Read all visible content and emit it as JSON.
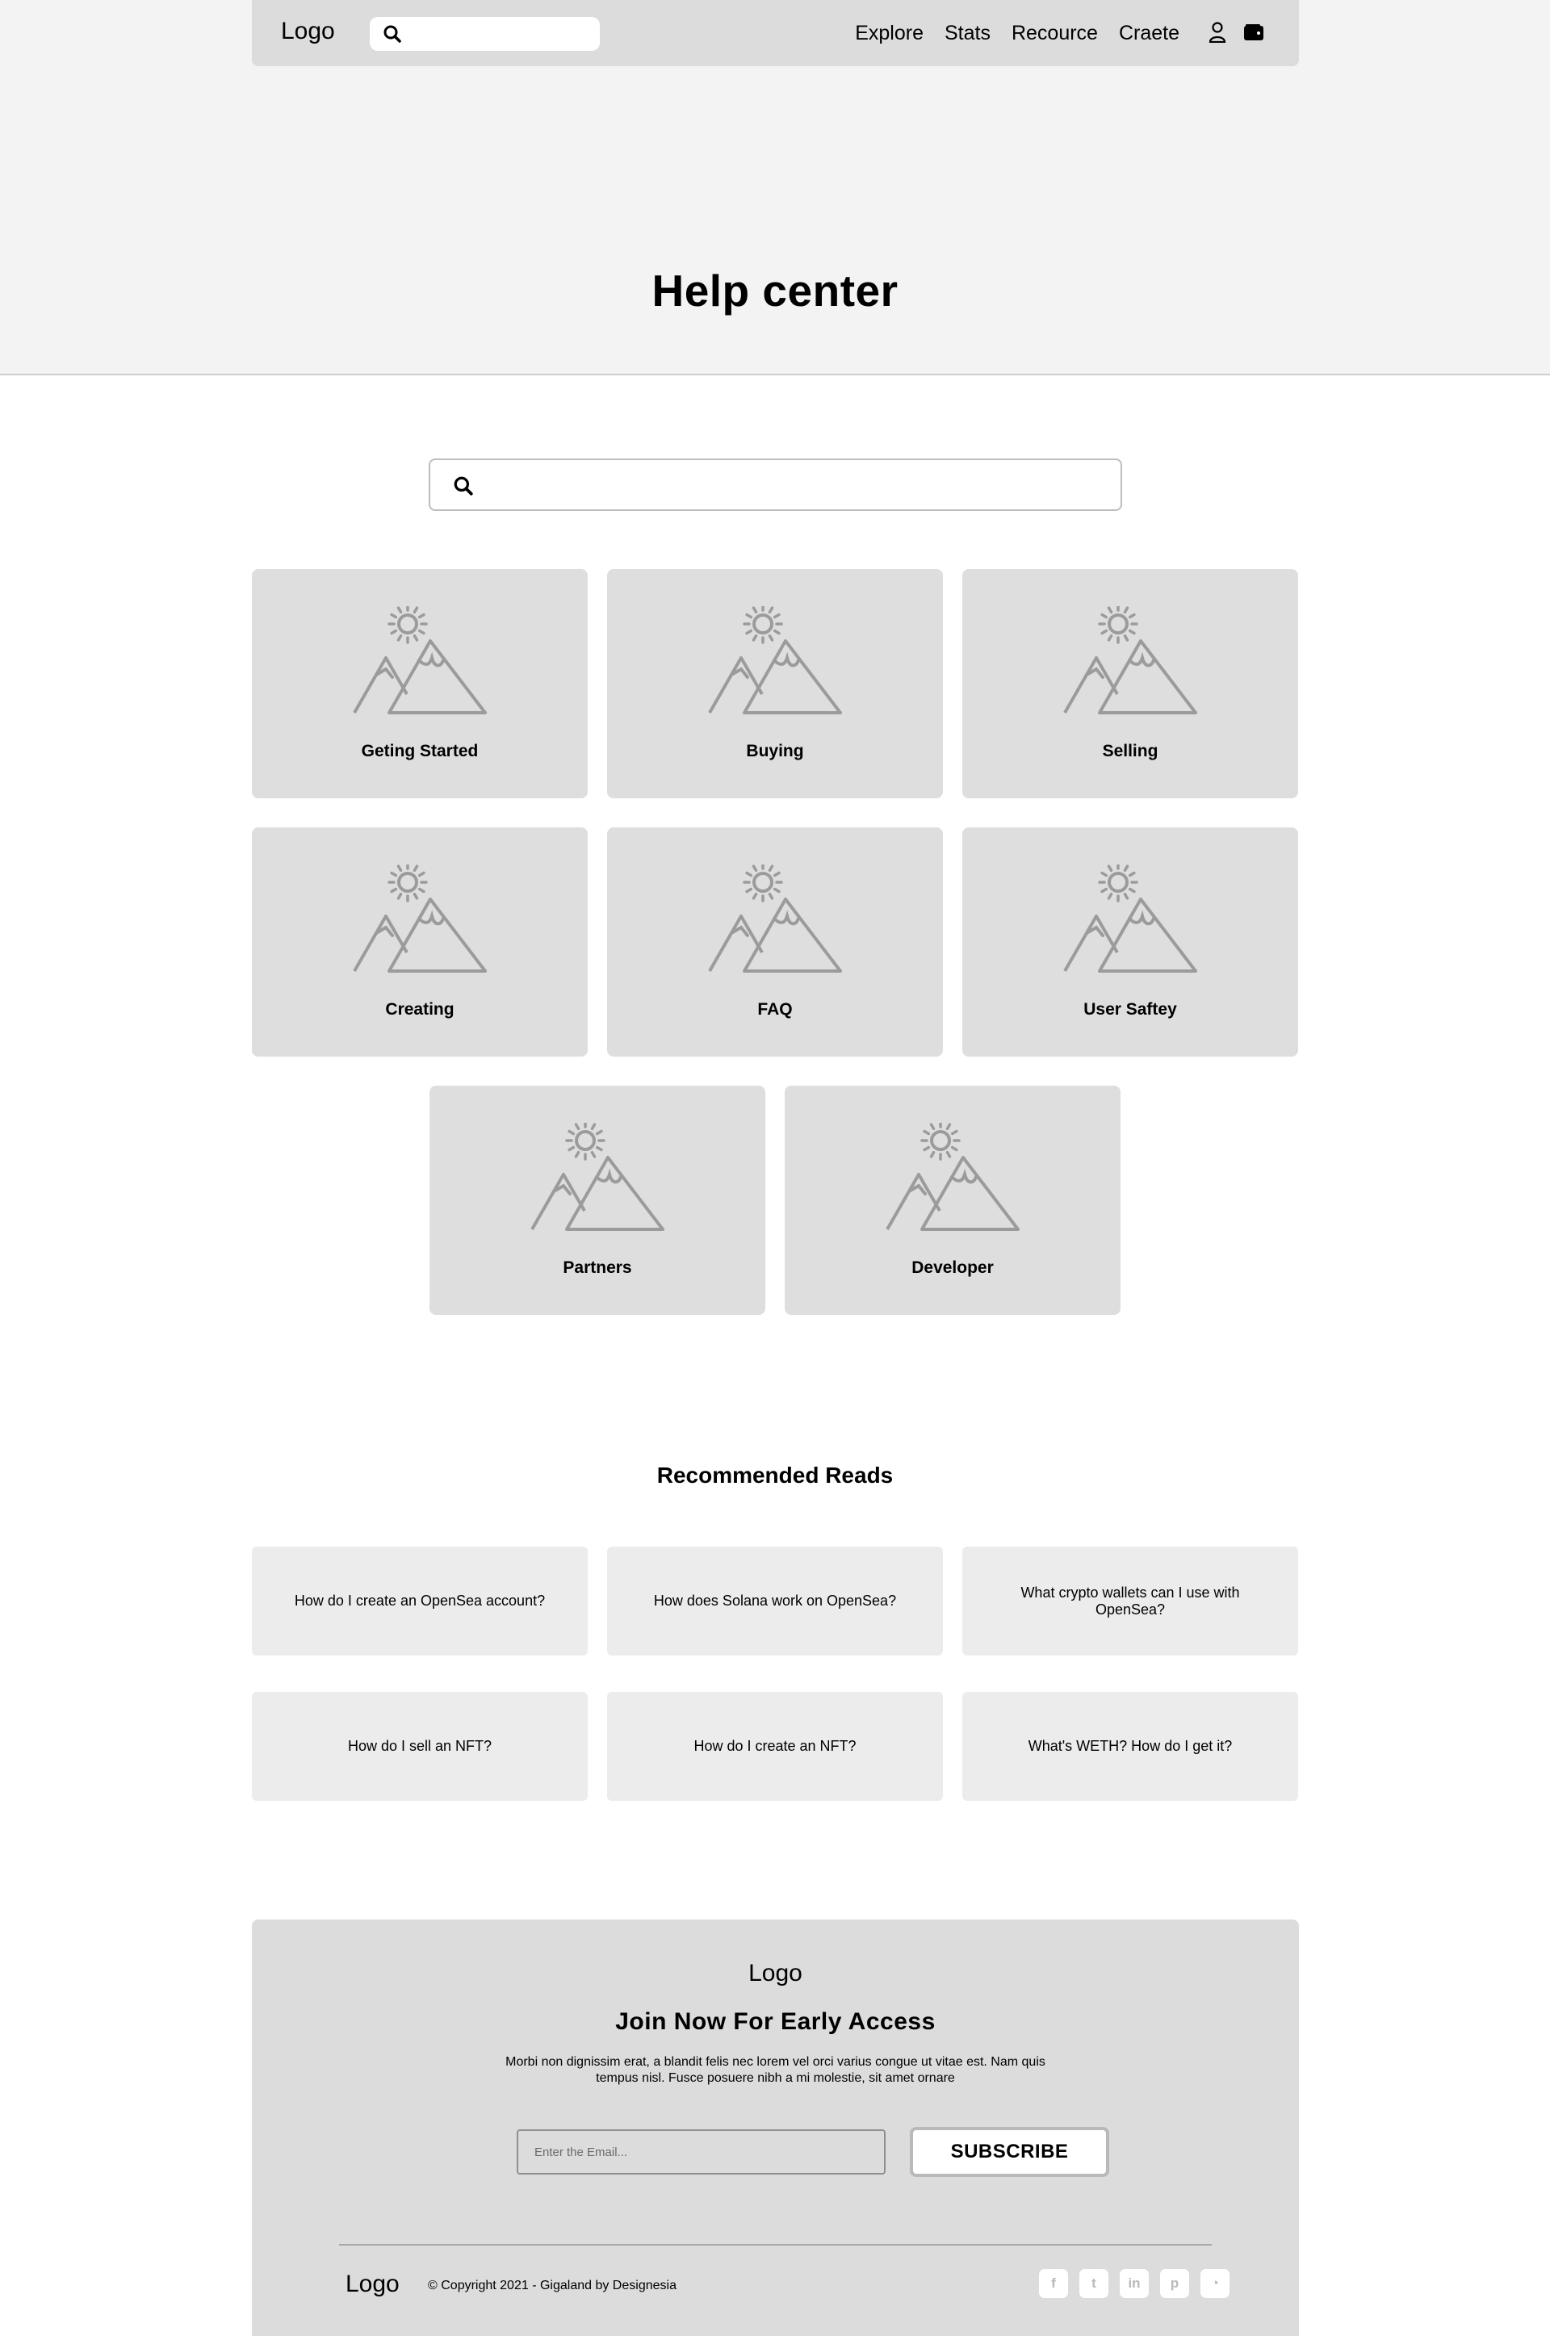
{
  "nav": {
    "logo": "Logo",
    "search_placeholder": "",
    "links": [
      "Explore",
      "Stats",
      "Recource",
      "Craete"
    ]
  },
  "hero": {
    "title": "Help center"
  },
  "search": {
    "placeholder": ""
  },
  "categories": [
    "Geting Started",
    "Buying",
    "Selling",
    "Creating",
    "FAQ",
    "User Saftey",
    "Partners",
    "Developer"
  ],
  "recommended": {
    "title": "Recommended Reads",
    "items": [
      "How do I create an OpenSea account?",
      "How does Solana work on OpenSea?",
      "What crypto wallets can I use with OpenSea?",
      "How do I sell an NFT?",
      "How do I create an NFT?",
      "What's WETH? How do I get it?"
    ]
  },
  "footer": {
    "logo": "Logo",
    "title": "Join Now For Early Access",
    "description": "Morbi non dignissim erat, a blandit felis nec lorem vel orci varius congue ut vitae est. Nam quis tempus nisl. Fusce posuere nibh a mi molestie, sit amet ornare",
    "email_placeholder": "Enter the Email...",
    "subscribe_label": "SUBSCRIBE",
    "bottom_logo": "Logo",
    "copyright": "© Copyright 2021 - Gigaland by Designesia",
    "socials": [
      "facebook-icon",
      "twitter-icon",
      "linkedin-icon",
      "pinterest-icon",
      "rss-icon"
    ],
    "social_glyphs": [
      "f",
      "t",
      "in",
      "p",
      "◔"
    ]
  },
  "colors": {
    "hero_bg": "#f3f3f3",
    "card_bg": "#dedede",
    "rec_bg": "#ececec",
    "footer_bg": "#dcdcdc",
    "placeholder_icon": "#9b9b9b"
  }
}
